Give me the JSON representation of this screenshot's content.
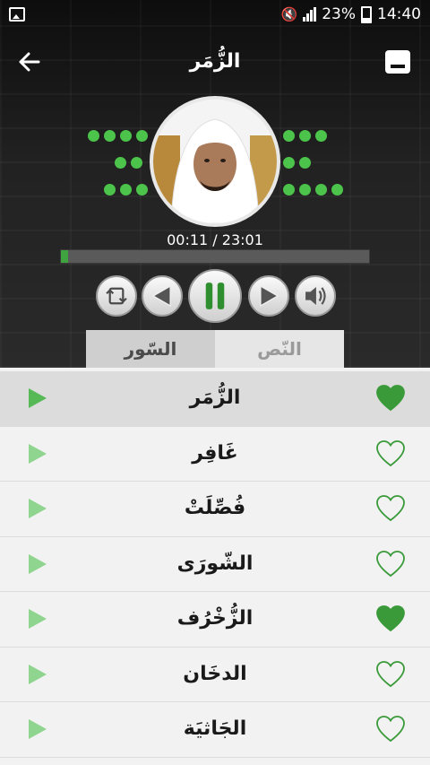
{
  "status_bar": {
    "battery": "23%",
    "time": "14:40",
    "icons": [
      "gallery-icon",
      "mute-icon",
      "signal-icon",
      "battery-icon"
    ]
  },
  "toolbar": {
    "title": "الزُّمَر",
    "back_icon": "arrow-left-icon",
    "minimize_icon": "minimize-icon"
  },
  "player": {
    "current_time": "00:11",
    "separator": " / ",
    "total_time": "23:01",
    "progress_fraction": 0.024,
    "controls": [
      "repeat-icon",
      "previous-icon",
      "pause-icon",
      "next-icon",
      "volume-icon"
    ]
  },
  "tabs": [
    {
      "label": "السّور",
      "active": true
    },
    {
      "label": "النّص",
      "active": false
    }
  ],
  "surahs": [
    {
      "name": "الزُّمَر",
      "favorite": true,
      "selected": true
    },
    {
      "name": "غَافِر",
      "favorite": false,
      "selected": false
    },
    {
      "name": "فُصِّلَتْ",
      "favorite": false,
      "selected": false
    },
    {
      "name": "الشّورَى",
      "favorite": false,
      "selected": false
    },
    {
      "name": "الزُّخْرُف",
      "favorite": true,
      "selected": false
    },
    {
      "name": "الدخَان",
      "favorite": false,
      "selected": false
    },
    {
      "name": "الجَاثيَة",
      "favorite": false,
      "selected": false
    }
  ],
  "colors": {
    "accent_green": "#3fa33f",
    "heart_filled": "#3a9a3a",
    "dot_green": "#4cc44c"
  }
}
